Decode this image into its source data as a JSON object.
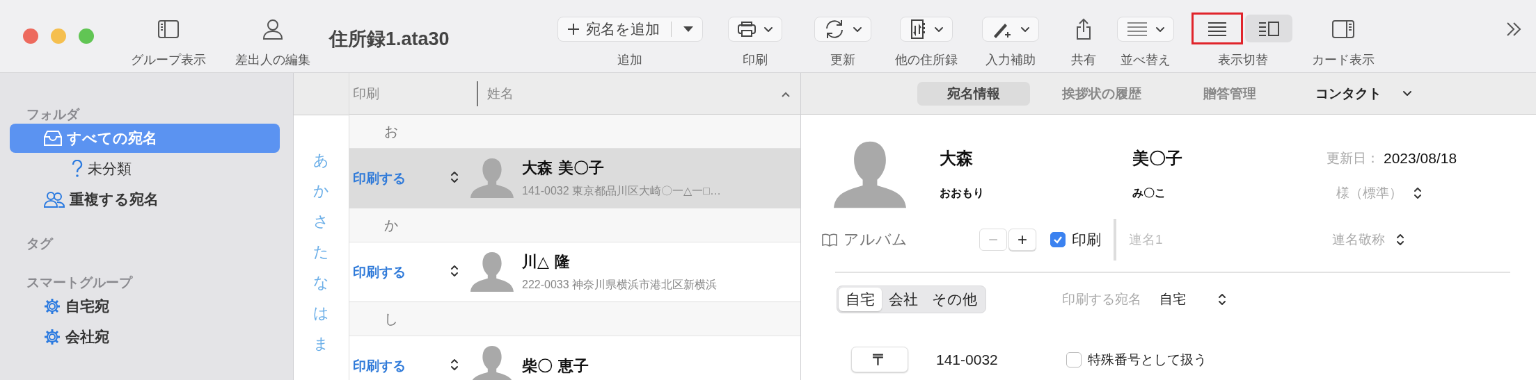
{
  "window": {
    "title": "住所録1.ata30",
    "controls": [
      {
        "kind": "close"
      },
      {
        "kind": "minimize"
      },
      {
        "kind": "zoom"
      }
    ]
  },
  "toolbar": {
    "items": [
      {
        "kind": "sidebar",
        "label": "グループ表示"
      },
      {
        "kind": "person",
        "label": "差出人の編集"
      },
      {
        "kind": "title"
      },
      {
        "kind": "add",
        "text": "宛名を追加",
        "label": "追加"
      },
      {
        "kind": "printer",
        "label": "印刷"
      },
      {
        "kind": "sync",
        "label": "更新"
      },
      {
        "kind": "addressbooks",
        "label": "他の住所録"
      },
      {
        "kind": "pen",
        "label": "入力補助"
      },
      {
        "kind": "share",
        "label": "共有"
      },
      {
        "kind": "sort",
        "label": "並べ替え"
      },
      {
        "kind": "segments",
        "label": "表示切替",
        "segments": [
          {
            "kind": "list",
            "selected": false,
            "highlighted": true
          },
          {
            "kind": "detail-list",
            "selected": true,
            "highlighted": false
          }
        ]
      },
      {
        "kind": "card",
        "label": "カード表示"
      },
      {
        "kind": "overflow"
      }
    ]
  },
  "sidebar": {
    "sections": [
      {
        "heading": "フォルダ",
        "items": [
          {
            "kind": "inbox",
            "label": "すべての宛名",
            "selected": true,
            "children": [
              {
                "kind": "question",
                "label": "未分類",
                "selected": false
              }
            ]
          },
          {
            "kind": "people",
            "label": "重複する宛名",
            "selected": false
          }
        ]
      },
      {
        "heading": "タグ"
      },
      {
        "heading": "スマートグループ",
        "items": [
          {
            "kind": "gear",
            "label": "自宅宛",
            "selected": false
          },
          {
            "kind": "gear",
            "label": "会社宛",
            "selected": false
          }
        ]
      }
    ]
  },
  "index_bar": [
    "あ",
    "か",
    "さ",
    "た",
    "な",
    "は",
    "ま"
  ],
  "list": {
    "columns": [
      "印刷",
      "姓名"
    ],
    "groups": [
      {
        "heading": "お",
        "rows": [
          {
            "print": "印刷する",
            "name": "大森 美〇子",
            "address": "141-0032 東京都品川区大崎〇一△一□…",
            "selected": true
          }
        ]
      },
      {
        "heading": "か",
        "rows": [
          {
            "print": "印刷する",
            "name": "川△ 隆",
            "address": "222-0033 神奈川県横浜市港北区新横浜",
            "selected": false
          }
        ]
      },
      {
        "heading": "し",
        "rows": [
          {
            "print": "印刷する",
            "name": "柴〇 恵子",
            "selected": false
          }
        ]
      }
    ]
  },
  "detail": {
    "tabs": [
      {
        "kind": "tab",
        "label": "宛名情報",
        "selected": true
      },
      {
        "kind": "tab",
        "label": "挨拶状の履歴",
        "selected": false
      },
      {
        "kind": "tab",
        "label": "贈答管理",
        "selected": false
      },
      {
        "kind": "menu",
        "label": "コンタクト",
        "selected": false
      }
    ],
    "last_name": "大森",
    "first_name": "美〇子",
    "updated_label": "更新日：",
    "updated": "2023/08/18",
    "last_name_kana": "おおもり",
    "first_name_kana": "み〇こ",
    "honorific": "様（標準）",
    "album_label": "アルバム",
    "stepper": {
      "minus": "−",
      "plus": "+",
      "minus_disabled": true
    },
    "print_checkbox": {
      "label": "印刷",
      "checked": true
    },
    "joint_name": {
      "placeholder": "連名1"
    },
    "joint_honorific": "連名敬称",
    "address_tabs": [
      {
        "label": "自宅",
        "selected": true
      },
      {
        "label": "会社",
        "selected": false
      },
      {
        "label": "その他",
        "selected": false
      }
    ],
    "print_address_label": "印刷する宛名",
    "print_address_value": "自宅",
    "postal_button": "〒",
    "postal_code": "141-0032",
    "special_checkbox": {
      "label": "特殊番号として扱う",
      "checked": false
    }
  }
}
